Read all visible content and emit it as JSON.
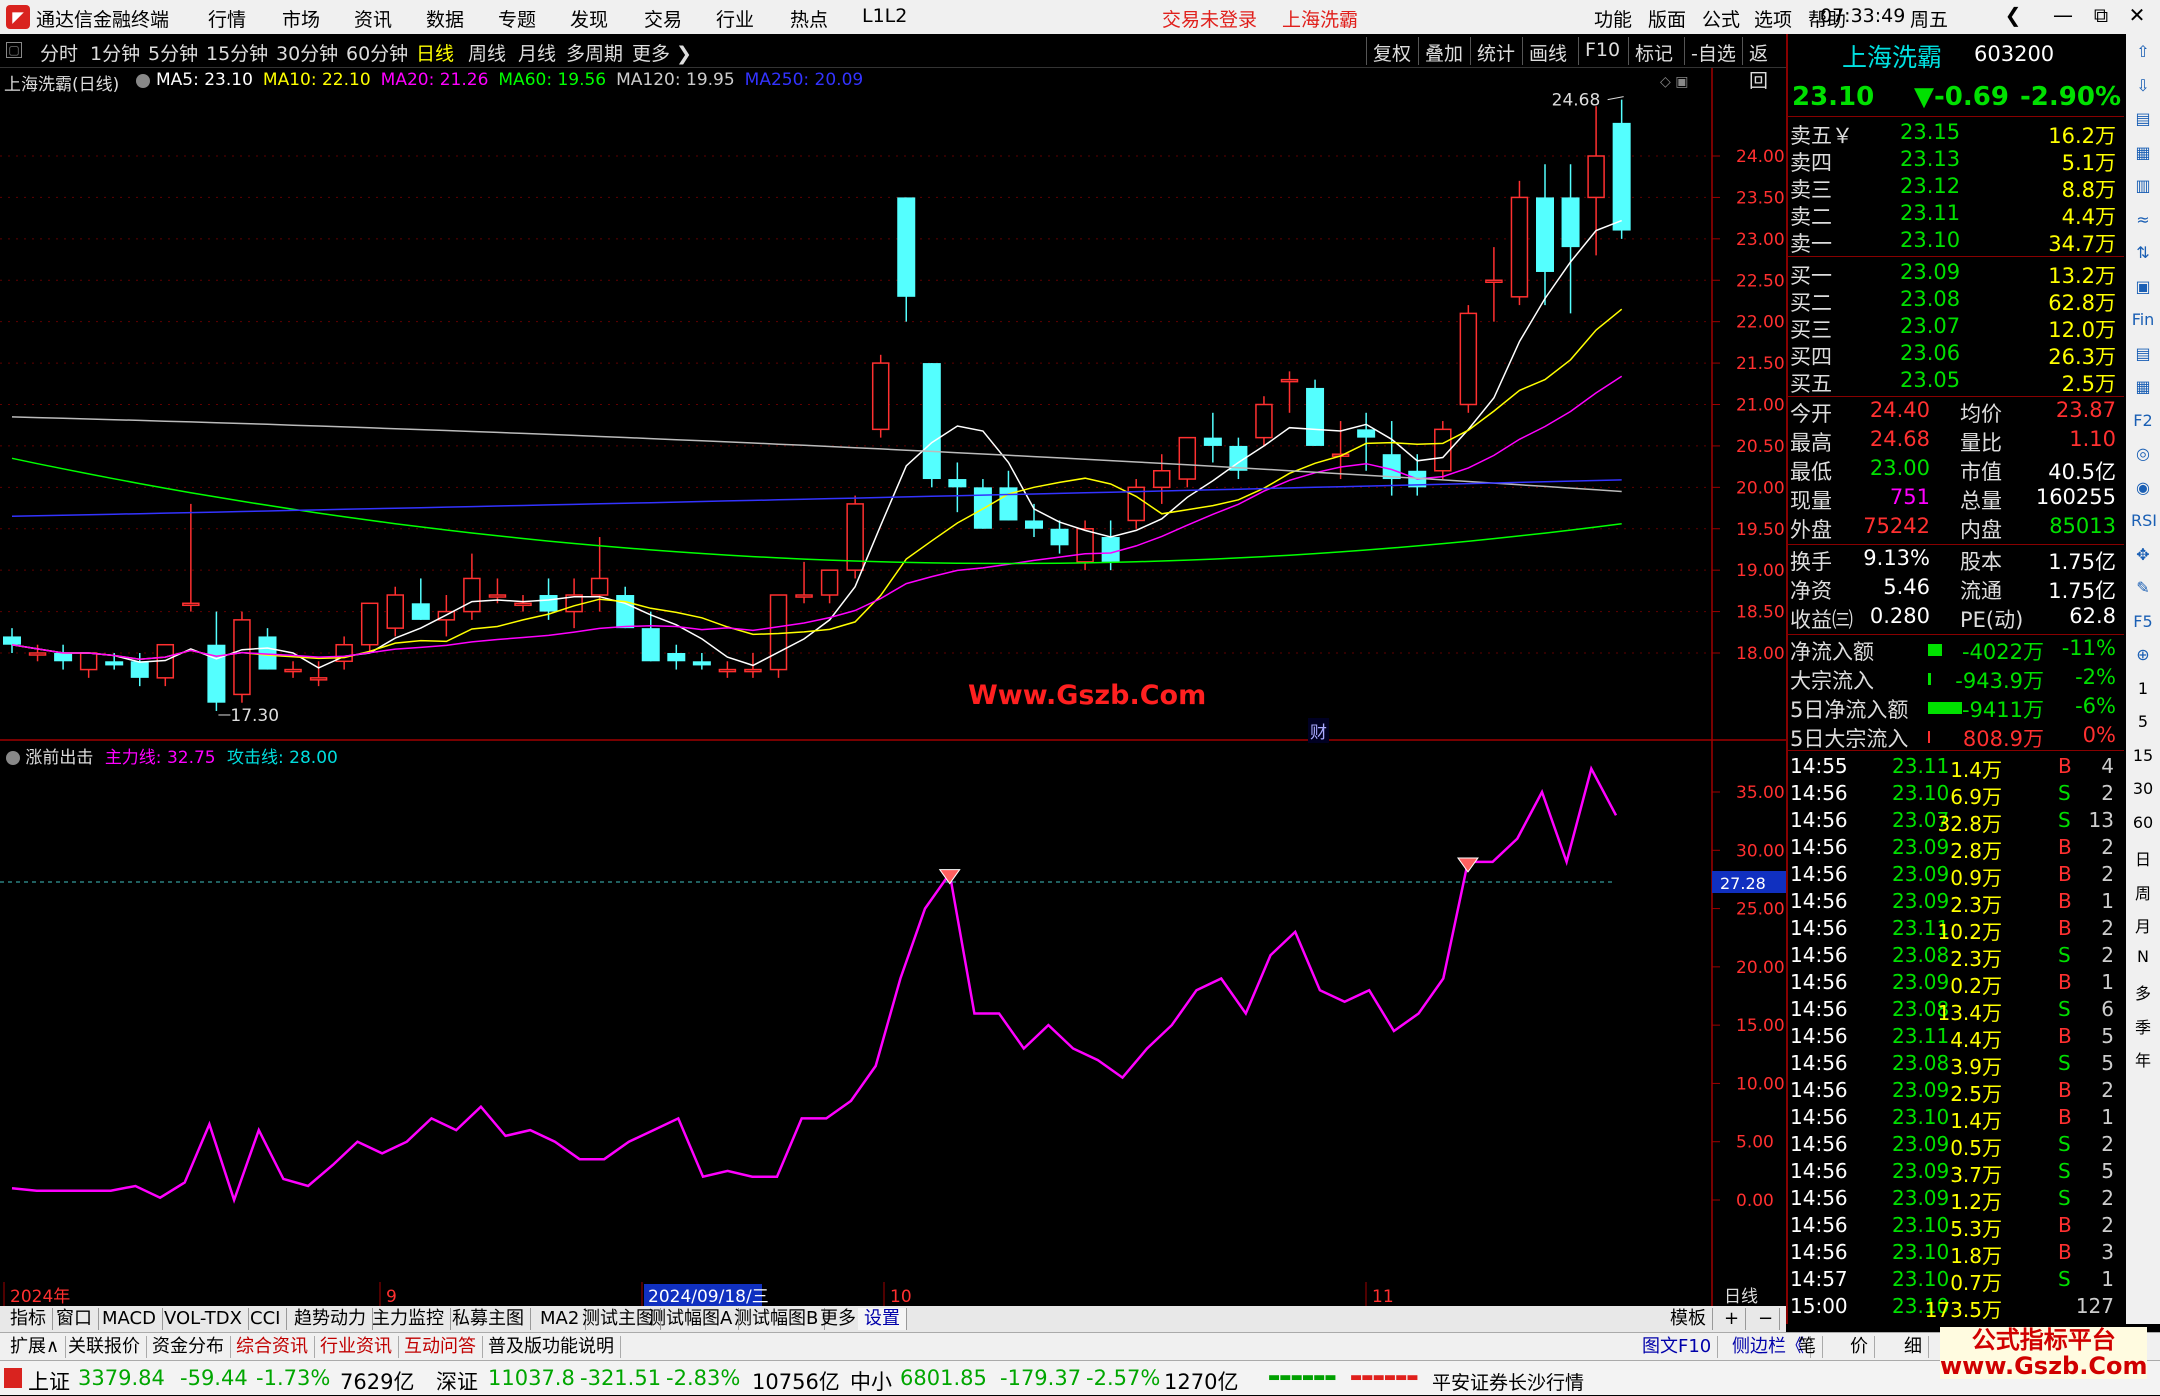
{
  "app": {
    "title": "通达信金融终端",
    "menus": [
      "行情",
      "市场",
      "资讯",
      "数据",
      "专题",
      "发现",
      "交易",
      "行业",
      "热点",
      "L1L2"
    ],
    "login_notice": "交易未登录",
    "stock_name_top": "上海洗霸",
    "right_menus": [
      "功能",
      "版面",
      "公式",
      "选项",
      "帮助"
    ],
    "time": "07:33:49",
    "weekday": "周五",
    "window_buttons": [
      "❮",
      "—",
      "⧉",
      "✕"
    ]
  },
  "periods": {
    "tabs": [
      "分时",
      "1分钟",
      "5分钟",
      "15分钟",
      "30分钟",
      "60分钟",
      "日线",
      "周线",
      "月线",
      "多周期",
      "更多 ❯"
    ],
    "active": "日线",
    "right_buttons": [
      "复权",
      "叠加",
      "统计",
      "画线",
      "F10",
      "标记",
      "-自选",
      "返回"
    ]
  },
  "main_chart": {
    "header": "上海洗霸(日线)",
    "ma_labels": [
      {
        "text": "MA5: 23.10",
        "color": "#ffffff"
      },
      {
        "text": "MA10: 22.10",
        "color": "#ffff00"
      },
      {
        "text": "MA20: 21.26",
        "color": "#ff00ff"
      },
      {
        "text": "MA60: 19.56",
        "color": "#00ff00"
      },
      {
        "text": "MA120: 19.95",
        "color": "#cccccc"
      },
      {
        "text": "MA250: 20.09",
        "color": "#3333ff"
      }
    ],
    "y_ticks": [
      "24.00",
      "23.50",
      "23.00",
      "22.50",
      "22.00",
      "21.50",
      "21.00",
      "20.50",
      "20.00",
      "19.50",
      "19.00",
      "18.50",
      "18.00"
    ],
    "high_label": "24.68",
    "low_label": "17.30",
    "watermark": "Www.Gszb.Com",
    "event_marker": "财",
    "x_labels": [
      "2024年",
      "9",
      "2024/09/18/三",
      "10",
      "11"
    ],
    "period_label": "日线"
  },
  "sub_chart": {
    "header": "涨前出击",
    "line1": "主力线: 32.75",
    "line2": "攻击线: 28.00",
    "y_ticks": [
      "35.00",
      "30.00",
      "25.00",
      "20.00",
      "15.00",
      "10.00",
      "5.00",
      "0.00"
    ],
    "ref_label": "27.28"
  },
  "chart_data": {
    "type": "candlestick",
    "title": "上海洗霸(日线)",
    "ylim": [
      17.3,
      24.68
    ],
    "candles": [
      [
        18.2,
        18.3,
        18.0,
        18.1
      ],
      [
        18.0,
        18.1,
        17.9,
        18.0
      ],
      [
        18.0,
        18.1,
        17.8,
        17.9
      ],
      [
        17.8,
        18.0,
        17.7,
        18.0
      ],
      [
        17.9,
        18.0,
        17.8,
        17.85
      ],
      [
        17.9,
        18.0,
        17.6,
        17.7
      ],
      [
        17.7,
        18.1,
        17.6,
        18.1
      ],
      [
        18.6,
        19.8,
        18.5,
        18.6
      ],
      [
        18.1,
        18.5,
        17.3,
        17.4
      ],
      [
        17.5,
        18.5,
        17.4,
        18.4
      ],
      [
        18.2,
        18.3,
        17.8,
        17.8
      ],
      [
        17.8,
        17.9,
        17.7,
        17.8
      ],
      [
        17.7,
        17.9,
        17.6,
        17.7
      ],
      [
        17.9,
        18.2,
        17.8,
        18.1
      ],
      [
        18.1,
        18.6,
        18.0,
        18.6
      ],
      [
        18.3,
        18.8,
        18.2,
        18.7
      ],
      [
        18.6,
        18.9,
        18.4,
        18.4
      ],
      [
        18.4,
        18.7,
        18.2,
        18.5
      ],
      [
        18.5,
        19.2,
        18.4,
        18.9
      ],
      [
        18.7,
        18.9,
        18.6,
        18.7
      ],
      [
        18.6,
        18.7,
        18.5,
        18.6
      ],
      [
        18.7,
        18.9,
        18.4,
        18.5
      ],
      [
        18.5,
        18.9,
        18.3,
        18.7
      ],
      [
        18.7,
        19.4,
        18.5,
        18.9
      ],
      [
        18.7,
        18.8,
        18.3,
        18.3
      ],
      [
        18.3,
        18.5,
        17.9,
        17.9
      ],
      [
        18.0,
        18.1,
        17.8,
        17.9
      ],
      [
        17.9,
        18.0,
        17.8,
        17.85
      ],
      [
        17.8,
        17.9,
        17.7,
        17.8
      ],
      [
        17.8,
        18.0,
        17.7,
        17.8
      ],
      [
        17.8,
        18.7,
        17.7,
        18.7
      ],
      [
        18.7,
        19.1,
        18.6,
        18.7
      ],
      [
        18.7,
        19.0,
        18.6,
        19.0
      ],
      [
        19.0,
        19.9,
        18.9,
        19.8
      ],
      [
        20.7,
        21.6,
        20.6,
        21.5
      ],
      [
        23.5,
        23.5,
        22.0,
        22.3
      ],
      [
        21.5,
        21.5,
        20.0,
        20.1
      ],
      [
        20.1,
        20.3,
        19.7,
        20.0
      ],
      [
        20.0,
        20.1,
        19.5,
        19.5
      ],
      [
        20.0,
        20.2,
        19.6,
        19.6
      ],
      [
        19.6,
        19.8,
        19.4,
        19.5
      ],
      [
        19.5,
        19.6,
        19.2,
        19.3
      ],
      [
        19.1,
        19.6,
        19.0,
        19.5
      ],
      [
        19.4,
        19.6,
        19.0,
        19.1
      ],
      [
        19.6,
        20.1,
        19.5,
        20.0
      ],
      [
        20.0,
        20.4,
        19.8,
        20.2
      ],
      [
        20.1,
        20.6,
        20.0,
        20.6
      ],
      [
        20.6,
        20.9,
        20.3,
        20.5
      ],
      [
        20.5,
        20.6,
        20.1,
        20.2
      ],
      [
        20.6,
        21.1,
        20.5,
        21.0
      ],
      [
        21.3,
        21.4,
        20.9,
        21.3
      ],
      [
        21.2,
        21.3,
        20.5,
        20.5
      ],
      [
        20.4,
        20.8,
        20.1,
        20.4
      ],
      [
        20.7,
        20.9,
        20.2,
        20.6
      ],
      [
        20.4,
        20.8,
        19.9,
        20.1
      ],
      [
        20.2,
        20.4,
        19.9,
        20.0
      ],
      [
        20.2,
        20.8,
        20.1,
        20.7
      ],
      [
        21.0,
        22.2,
        20.9,
        22.1
      ],
      [
        22.5,
        22.9,
        22.0,
        22.5
      ],
      [
        22.3,
        23.7,
        22.2,
        23.5
      ],
      [
        23.5,
        23.9,
        22.2,
        22.6
      ],
      [
        23.5,
        23.9,
        22.1,
        22.9
      ],
      [
        23.5,
        24.6,
        22.8,
        24.0
      ],
      [
        24.4,
        24.68,
        23.0,
        23.1
      ]
    ],
    "indicator": {
      "name": "涨前出击",
      "values": [
        1.0,
        0.8,
        0.8,
        0.8,
        0.8,
        1.2,
        0.2,
        1.5,
        6.5,
        0.0,
        6.0,
        1.8,
        1.2,
        3.0,
        5.0,
        4.0,
        5.0,
        7.0,
        6.0,
        8.0,
        5.5,
        6.0,
        5.0,
        3.5,
        3.5,
        5.0,
        6.0,
        7.0,
        2.0,
        2.5,
        2.0,
        2.0,
        7.0,
        7.0,
        8.5,
        11.5,
        19.0,
        25.0,
        28.0,
        16.0,
        16.0,
        13.0,
        15.0,
        13.0,
        12.0,
        10.5,
        13.0,
        15.0,
        18.0,
        19.0,
        16.0,
        21.0,
        23.0,
        18.0,
        17.0,
        18.0,
        14.5,
        16.0,
        19.0,
        29.0,
        29.0,
        31.0,
        35.0,
        29.0,
        37.0,
        33.0
      ],
      "ref_line": 27.28,
      "ylim": [
        -5,
        38
      ]
    }
  },
  "quote": {
    "name": "上海洗霸",
    "code": "603200",
    "price": "23.10",
    "change": "▼-0.69",
    "pct": "-2.90%",
    "asks": [
      {
        "label": "卖五￥",
        "price": "23.15",
        "vol": "16.2万"
      },
      {
        "label": "卖四",
        "price": "23.13",
        "vol": "5.1万"
      },
      {
        "label": "卖三",
        "price": "23.12",
        "vol": "8.8万"
      },
      {
        "label": "卖二",
        "price": "23.11",
        "vol": "4.4万"
      },
      {
        "label": "卖一",
        "price": "23.10",
        "vol": "34.7万"
      }
    ],
    "bids": [
      {
        "label": "买一",
        "price": "23.09",
        "vol": "13.2万"
      },
      {
        "label": "买二",
        "price": "23.08",
        "vol": "62.8万"
      },
      {
        "label": "买三",
        "price": "23.07",
        "vol": "12.0万"
      },
      {
        "label": "买四",
        "price": "23.06",
        "vol": "26.3万"
      },
      {
        "label": "买五",
        "price": "23.05",
        "vol": "2.5万"
      }
    ],
    "stats": [
      {
        "l1": "今开",
        "v1": "24.40",
        "c1": "#ff3030",
        "l2": "均价",
        "v2": "23.87",
        "c2": "#ff3030"
      },
      {
        "l1": "最高",
        "v1": "24.68",
        "c1": "#ff3030",
        "l2": "量比",
        "v2": "1.10",
        "c2": "#ff3030"
      },
      {
        "l1": "最低",
        "v1": "23.00",
        "c1": "#00e000",
        "l2": "市值",
        "v2": "40.5亿",
        "c2": "#ffffff"
      },
      {
        "l1": "现量",
        "v1": "751",
        "c1": "#ff00ff",
        "l2": "总量",
        "v2": "160255",
        "c2": "#ffffff"
      },
      {
        "l1": "外盘",
        "v1": "75242",
        "c1": "#ff3030",
        "l2": "内盘",
        "v2": "85013",
        "c2": "#00e000"
      }
    ],
    "stats2": [
      {
        "l1": "换手",
        "v1": "9.13%",
        "l2": "股本",
        "v2": "1.75亿"
      },
      {
        "l1": "净资",
        "v1": "5.46",
        "l2": "流通",
        "v2": "1.75亿"
      },
      {
        "l1": "收益㈢",
        "v1": "0.280",
        "l2": "PE(动)",
        "v2": "62.8"
      }
    ],
    "flows": [
      {
        "label": "净流入额",
        "val": "-4022万",
        "pct": "-11%",
        "bar": 14,
        "color": "#00e000"
      },
      {
        "label": "大宗流入",
        "val": "-943.9万",
        "pct": "-2%",
        "bar": 3,
        "color": "#00e000"
      },
      {
        "label": "5日净流入额",
        "val": "-9411万",
        "pct": "-6%",
        "bar": 34,
        "color": "#00e000"
      },
      {
        "label": "5日大宗流入",
        "val": "808.9万",
        "pct": "0%",
        "bar": 0,
        "color": "#ff3030"
      }
    ],
    "ticks": [
      {
        "t": "14:55",
        "p": "23.11",
        "v": "1.4万",
        "d": "B",
        "n": "4"
      },
      {
        "t": "14:56",
        "p": "23.10",
        "v": "6.9万",
        "d": "S",
        "n": "2"
      },
      {
        "t": "14:56",
        "p": "23.07",
        "v": "32.8万",
        "d": "S",
        "n": "13"
      },
      {
        "t": "14:56",
        "p": "23.09",
        "v": "2.8万",
        "d": "B",
        "n": "2"
      },
      {
        "t": "14:56",
        "p": "23.09",
        "v": "0.9万",
        "d": "B",
        "n": "2"
      },
      {
        "t": "14:56",
        "p": "23.09",
        "v": "2.3万",
        "d": "B",
        "n": "1"
      },
      {
        "t": "14:56",
        "p": "23.11",
        "v": "10.2万",
        "d": "B",
        "n": "2"
      },
      {
        "t": "14:56",
        "p": "23.08",
        "v": "2.3万",
        "d": "S",
        "n": "2"
      },
      {
        "t": "14:56",
        "p": "23.09",
        "v": "0.2万",
        "d": "B",
        "n": "1"
      },
      {
        "t": "14:56",
        "p": "23.08",
        "v": "13.4万",
        "d": "S",
        "n": "6"
      },
      {
        "t": "14:56",
        "p": "23.11",
        "v": "4.4万",
        "d": "B",
        "n": "5"
      },
      {
        "t": "14:56",
        "p": "23.08",
        "v": "3.9万",
        "d": "S",
        "n": "5"
      },
      {
        "t": "14:56",
        "p": "23.09",
        "v": "2.5万",
        "d": "B",
        "n": "2"
      },
      {
        "t": "14:56",
        "p": "23.10",
        "v": "1.4万",
        "d": "B",
        "n": "1"
      },
      {
        "t": "14:56",
        "p": "23.09",
        "v": "0.5万",
        "d": "S",
        "n": "2"
      },
      {
        "t": "14:56",
        "p": "23.09",
        "v": "3.7万",
        "d": "S",
        "n": "5"
      },
      {
        "t": "14:56",
        "p": "23.09",
        "v": "1.2万",
        "d": "S",
        "n": "2"
      },
      {
        "t": "14:56",
        "p": "23.10",
        "v": "5.3万",
        "d": "B",
        "n": "2"
      },
      {
        "t": "14:56",
        "p": "23.10",
        "v": "1.8万",
        "d": "B",
        "n": "3"
      },
      {
        "t": "14:57",
        "p": "23.10",
        "v": "0.7万",
        "d": "S",
        "n": "1"
      },
      {
        "t": "15:00",
        "p": "23.10",
        "v": "173.5万",
        "d": "",
        "n": "127"
      }
    ]
  },
  "tool_column": [
    "⇧",
    "⇩",
    "▤",
    "▦",
    "▥",
    "≈",
    "⇅",
    "▣",
    "Fin",
    "▤",
    "▦",
    "F2",
    "◎",
    "◉",
    "RSI",
    "✥",
    "✎",
    "F5",
    "⊕",
    "1",
    "5",
    "15",
    "30",
    "60",
    "日",
    "周",
    "月",
    "N",
    "多",
    "季",
    "年"
  ],
  "bottom_tabs": [
    "指标",
    "窗口",
    "MACD",
    "VOL-TDX",
    "CCI",
    "趋势动力",
    "主力监控",
    "私募主图",
    "MA2",
    "测试主图",
    "测试幅图A",
    "测试幅图B",
    "更多",
    "设置"
  ],
  "bottom_tabs_active": "设置",
  "bottom_right": [
    "模板",
    "+",
    "−"
  ],
  "bottom_tabs2": [
    "扩展∧",
    "关联报价",
    "资金分布",
    "综合资讯",
    "行业资讯",
    "互动问答",
    "普及版功能说明"
  ],
  "bottom_tabs2_right": [
    "图文F10",
    "侧边栏《",
    "笔",
    "价",
    "细",
    "势"
  ],
  "status": {
    "sh_label": "上证",
    "sh_val": "3379.84",
    "sh_chg": "-59.44",
    "sh_pct": "-1.73%",
    "sh_amt": "7629亿",
    "sz_label": "深证",
    "sz_val": "11037.8",
    "sz_chg": "-321.51",
    "sz_pct": "-2.83%",
    "sz_amt": "10756亿",
    "zx_label": "中小",
    "zx_val": "6801.85",
    "zx_chg": "-179.37",
    "zx_pct": "-2.57%",
    "zx_amt": "1270亿",
    "broker": "平安证券长沙行情",
    "watermark": "公式指标平台\nwww.Gszb.Com"
  }
}
